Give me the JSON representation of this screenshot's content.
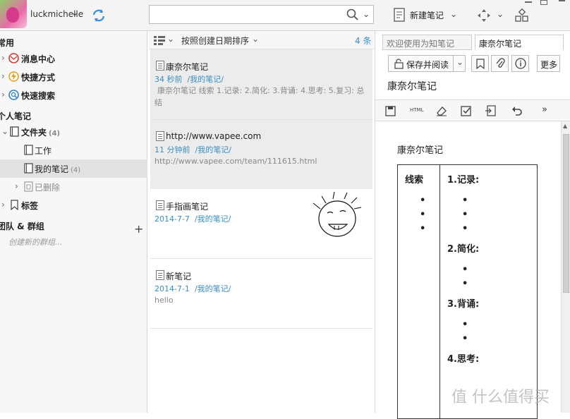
{
  "user": {
    "name": "luckmichelle"
  },
  "toolbar": {
    "new_note": "新建笔记"
  },
  "sidebar": {
    "common_header": "常用",
    "items": [
      {
        "label": "消息中心"
      },
      {
        "label": "快捷方式"
      },
      {
        "label": "快速搜索"
      }
    ],
    "personal_header": "个人笔记",
    "folder": {
      "label": "文件夹",
      "count": "(4)"
    },
    "sub": [
      {
        "label": "工作",
        "count": ""
      },
      {
        "label": "我的笔记",
        "count": "(4)"
      },
      {
        "label": "已删除",
        "count": ""
      }
    ],
    "tags": "标签",
    "team_header": "团队 & 群组",
    "create_group": "创建新的群组..."
  },
  "list": {
    "sort_label": "按照创建日期排序",
    "count": "4 条",
    "notes": [
      {
        "title": "康奈尔笔记",
        "date": "34 秒前",
        "folder": "/我的笔记/",
        "preview": "康奈尔笔记 线索 1.记录: 2.简化: 3.背诵: 4.思考: 5.复习: 总结"
      },
      {
        "title": "http://www.vapee.com",
        "date": "11 分钟前",
        "folder": "/我的笔记/",
        "preview": "http://www.vapee.com/team/111615.html"
      },
      {
        "title": "手指画笔记",
        "date": "2014-7-7",
        "folder": "/我的笔记/",
        "preview": ""
      },
      {
        "title": "新笔记",
        "date": "2014-7-1",
        "folder": "/我的笔记/",
        "preview": "hello"
      }
    ]
  },
  "editor": {
    "tabs": [
      {
        "label": "欢迎使用为知笔记"
      },
      {
        "label": "康奈尔笔记"
      }
    ],
    "save_read": "保存并阅读",
    "more": "更多",
    "title": "康奈尔笔记",
    "html_label": "HTML",
    "doc_title": "康奈尔笔记",
    "cue_label": "线索",
    "sections": [
      "1.记录:",
      "2.简化:",
      "3.背诵:",
      "4.思考:"
    ],
    "watermark": "值 什么值得买"
  }
}
